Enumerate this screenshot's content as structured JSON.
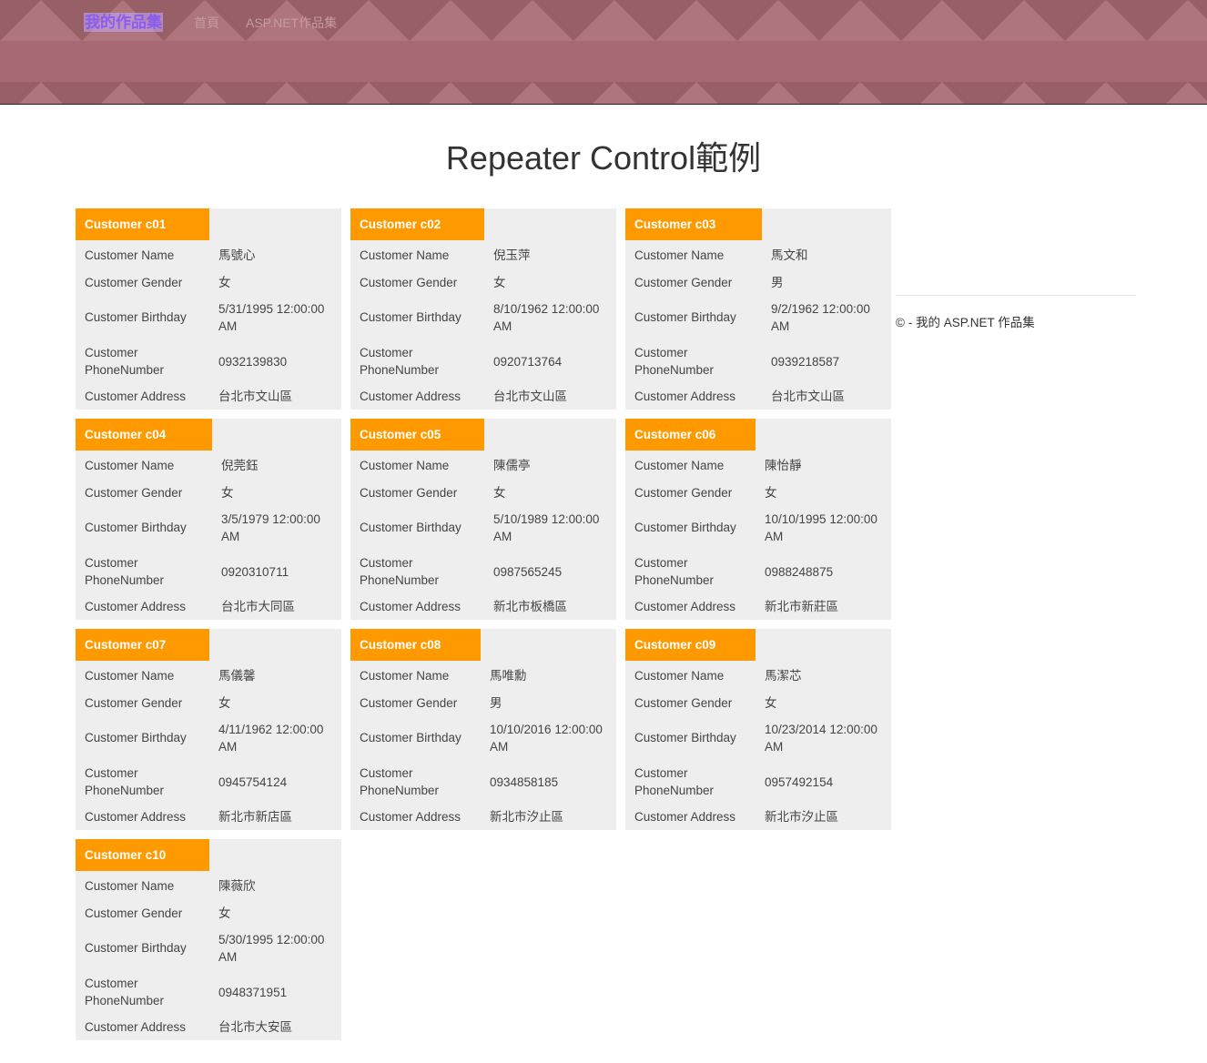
{
  "nav": {
    "brand": "我的作品集",
    "links": [
      "首頁",
      "ASP.NET作品集"
    ]
  },
  "page": {
    "title": "Repeater Control範例"
  },
  "labels": {
    "name": "Customer Name",
    "gender": "Customer Gender",
    "birthday": "Customer Birthday",
    "phone": "Customer PhoneNumber",
    "address": "Customer Address"
  },
  "customers": [
    {
      "header": "Customer c01",
      "name": "馬號心",
      "gender": "女",
      "birthday": "5/31/1995 12:00:00 AM",
      "phone": "0932139830",
      "address": "台北市文山區"
    },
    {
      "header": "Customer c02",
      "name": "倪玉萍",
      "gender": "女",
      "birthday": "8/10/1962 12:00:00 AM",
      "phone": "0920713764",
      "address": "台北市文山區"
    },
    {
      "header": "Customer c03",
      "name": "馬文和",
      "gender": "男",
      "birthday": "9/2/1962 12:00:00 AM",
      "phone": "0939218587",
      "address": "台北市文山區"
    },
    {
      "header": "Customer c04",
      "name": "倪莞鈺",
      "gender": "女",
      "birthday": "3/5/1979 12:00:00 AM",
      "phone": "0920310711",
      "address": "台北市大同區"
    },
    {
      "header": "Customer c05",
      "name": "陳儒亭",
      "gender": "女",
      "birthday": "5/10/1989 12:00:00 AM",
      "phone": "0987565245",
      "address": "新北市板橋區"
    },
    {
      "header": "Customer c06",
      "name": "陳怡靜",
      "gender": "女",
      "birthday": "10/10/1995 12:00:00 AM",
      "phone": "0988248875",
      "address": "新北市新莊區"
    },
    {
      "header": "Customer c07",
      "name": "馬儀馨",
      "gender": "女",
      "birthday": "4/11/1962 12:00:00 AM",
      "phone": "0945754124",
      "address": "新北市新店區"
    },
    {
      "header": "Customer c08",
      "name": "馬唯勳",
      "gender": "男",
      "birthday": "10/10/2016 12:00:00 AM",
      "phone": "0934858185",
      "address": "新北市汐止區"
    },
    {
      "header": "Customer c09",
      "name": "馬潔芯",
      "gender": "女",
      "birthday": "10/23/2014 12:00:00 AM",
      "phone": "0957492154",
      "address": "新北市汐止區"
    },
    {
      "header": "Customer c10",
      "name": "陳薇欣",
      "gender": "女",
      "birthday": "5/30/1995 12:00:00 AM",
      "phone": "0948371951",
      "address": "台北市大安區"
    }
  ],
  "footer": {
    "text": "© - 我的 ASP.NET 作品集"
  },
  "colors": {
    "accent": "#ff9900",
    "card_bg": "#eeeeee",
    "nav_bg": "#a86a72",
    "brand": "#8a5cf0"
  }
}
